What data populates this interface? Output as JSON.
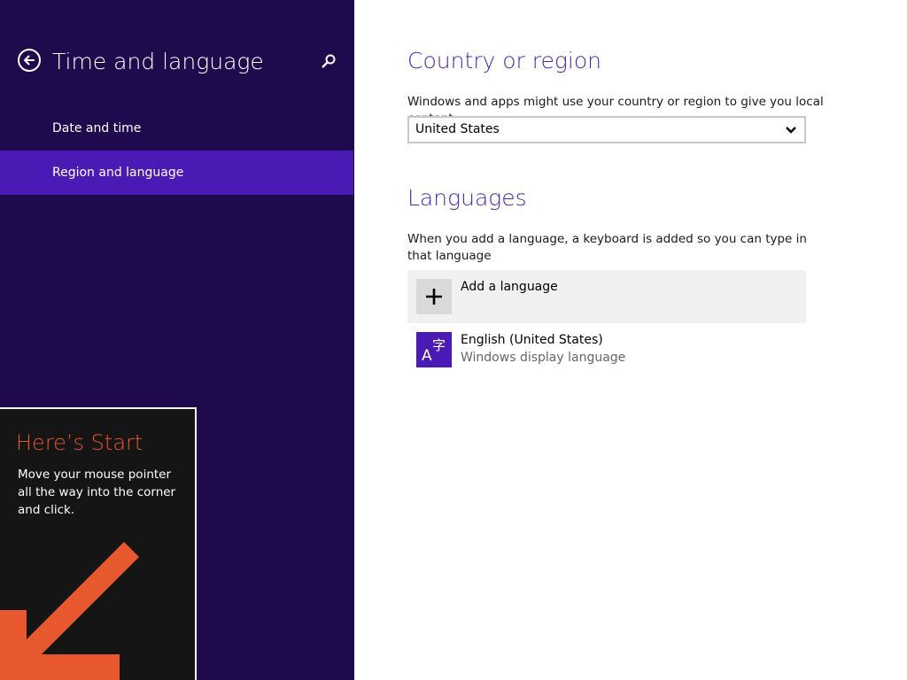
{
  "nav": {
    "title": "Time and language",
    "items": [
      {
        "label": "Date and time",
        "selected": false
      },
      {
        "label": "Region and language",
        "selected": true
      }
    ],
    "back_icon": "back-arrow-icon",
    "search_icon": "search-icon"
  },
  "country_section": {
    "heading": "Country or region",
    "description": "Windows and apps might use your country or region to give you local content",
    "selected_country": "United States"
  },
  "languages_section": {
    "heading": "Languages",
    "description": "When you add a language, a keyboard is added so you can type in that language",
    "add_label": "Add a language",
    "items": [
      {
        "name": "English (United States)",
        "subtitle": "Windows display language"
      }
    ]
  },
  "start_tip": {
    "title": "Here’s Start",
    "body": "Move your mouse pointer all the way into the corner and click."
  },
  "colors": {
    "nav_background": "#1f0a4e",
    "accent": "#4a1bb4",
    "heading": "#4a2ab8",
    "tip_title": "#e8582e"
  }
}
